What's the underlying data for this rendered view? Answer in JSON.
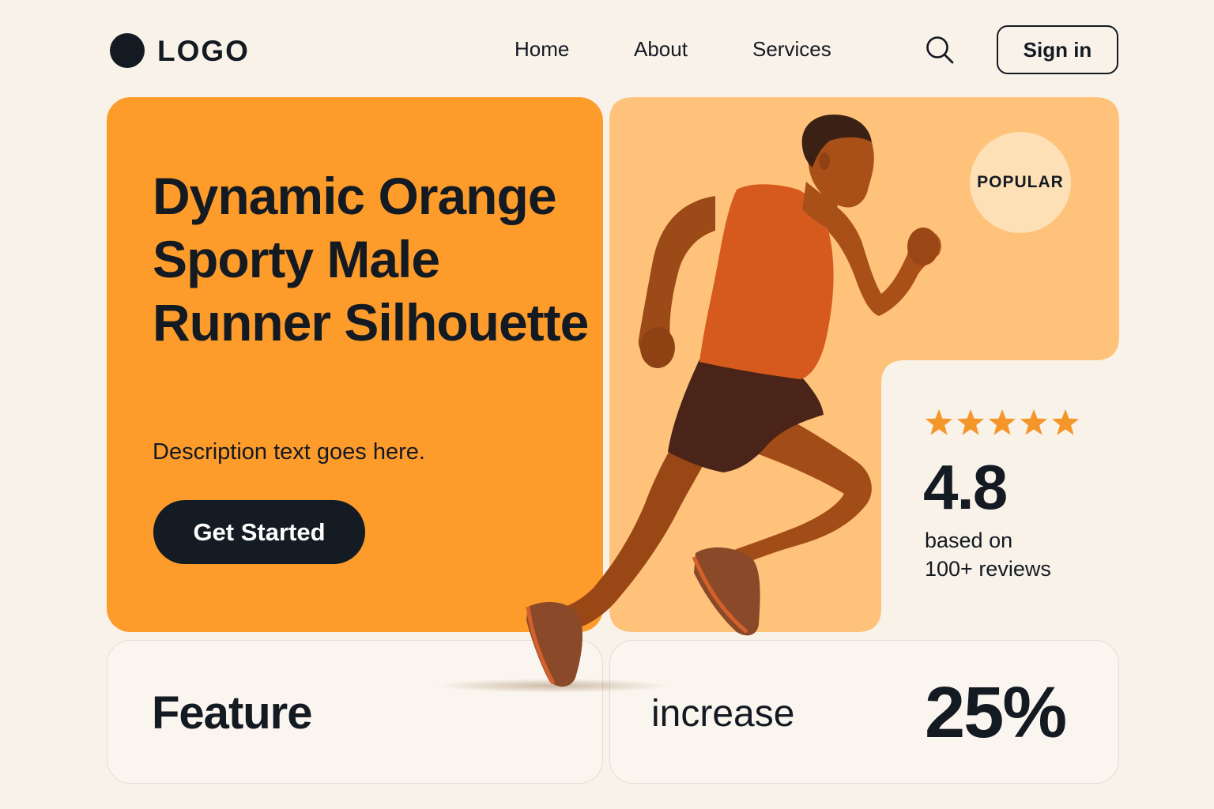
{
  "header": {
    "logo_text": "LOGO",
    "nav": [
      {
        "label": "Home"
      },
      {
        "label": "About"
      },
      {
        "label": "Services"
      }
    ],
    "search_icon": "search-icon",
    "signin_label": "Sign in"
  },
  "hero": {
    "title": "Dynamic Orange Sporty Male Runner Silhouette",
    "description": "Description text goes here.",
    "cta_label": "Get Started",
    "image": "runner-photo"
  },
  "badge": {
    "label": "POPULAR"
  },
  "rating": {
    "stars": 5,
    "value": "4.8",
    "line1": "based on",
    "line2": "100+ reviews"
  },
  "feature": {
    "label": "Feature"
  },
  "stat": {
    "label": "increase",
    "value": "25%"
  },
  "colors": {
    "background": "#f8f2e9",
    "accent_orange": "#fd9b2b",
    "light_orange": "#fec27a",
    "badge": "#fde0b5",
    "dark": "#141a22",
    "star": "#f5962a"
  }
}
